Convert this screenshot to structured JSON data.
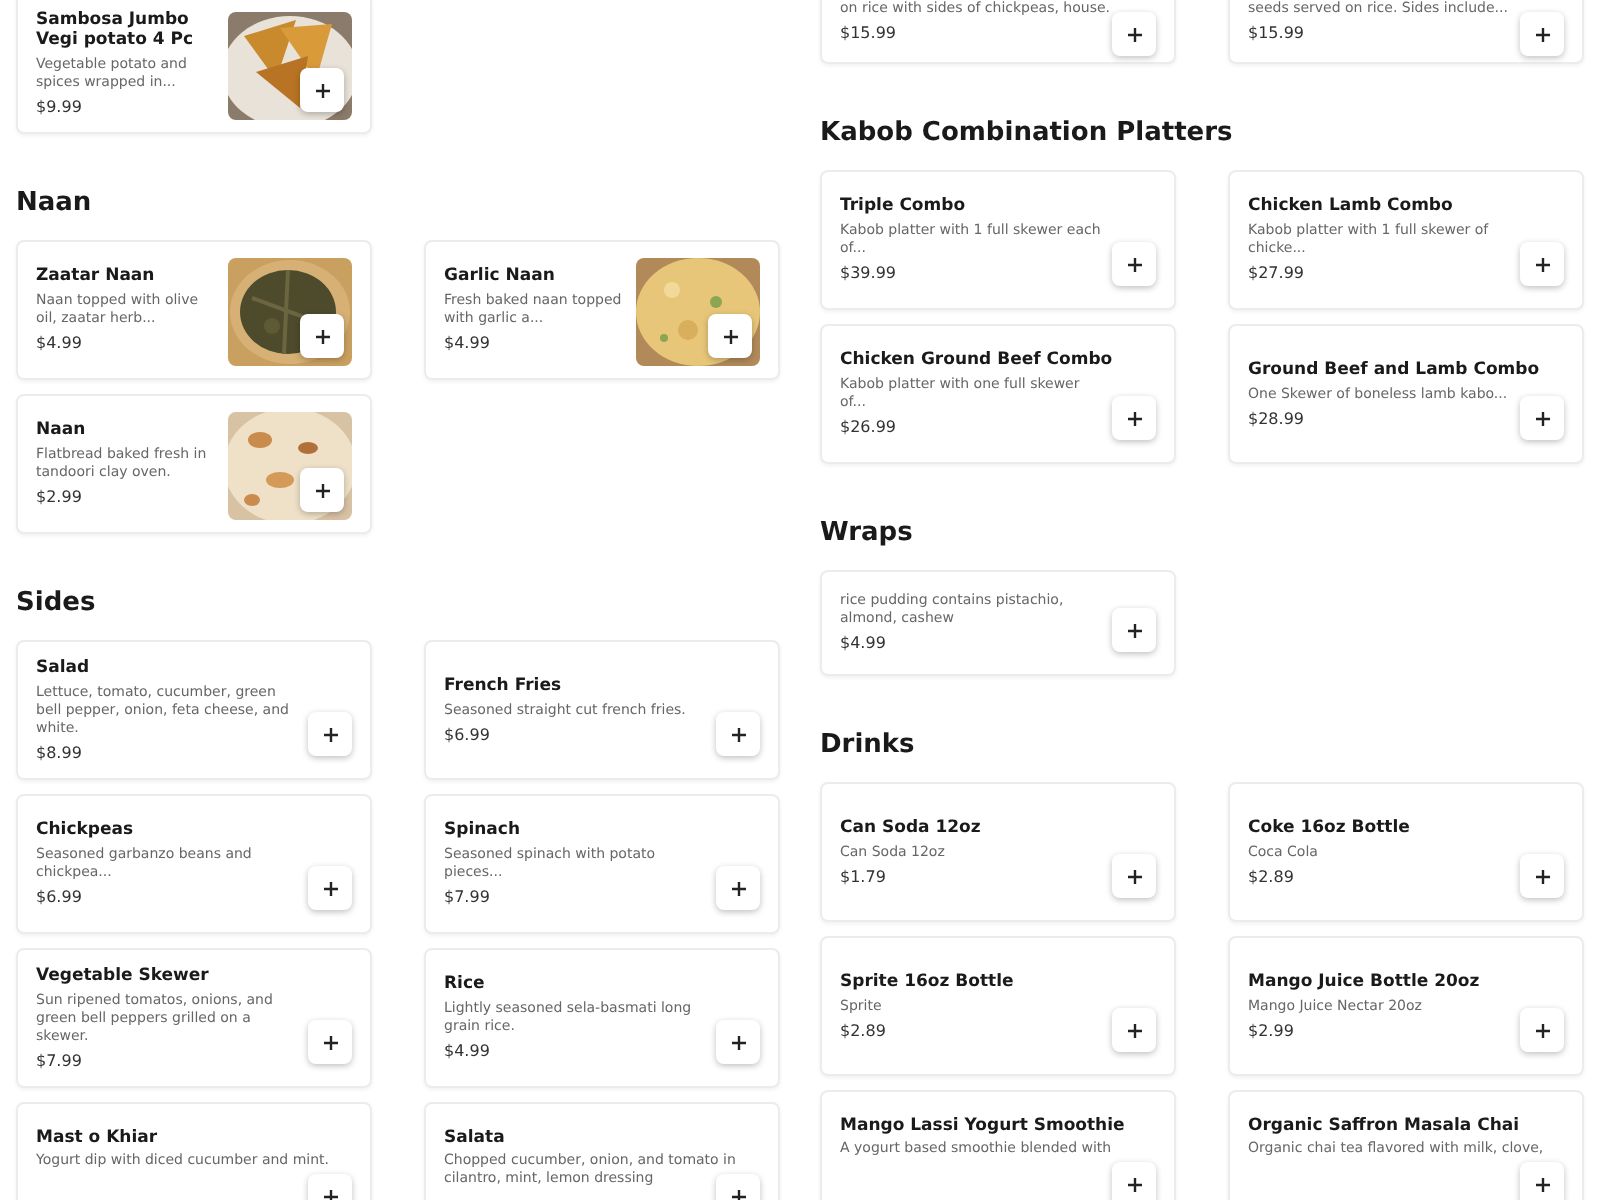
{
  "left": [
    {
      "items": [
        {
          "title": "Sambosa Jumbo Vegi potato 4 Pc",
          "description": "Vegetable potato and spices wrapped in...",
          "price": "$9.99"
        }
      ]
    },
    {
      "heading": "Naan",
      "items": [
        {
          "title": "Zaatar Naan",
          "description": "Naan topped with olive oil, zaatar herb...",
          "price": "$4.99"
        },
        {
          "title": "Garlic Naan",
          "description": "Fresh baked naan topped with garlic a...",
          "price": "$4.99"
        },
        {
          "title": "Naan",
          "description": "Flatbread baked fresh in tandoori clay oven.",
          "price": "$2.99"
        }
      ]
    },
    {
      "heading": "Sides",
      "items": [
        {
          "title": "Salad",
          "description": "Lettuce, tomato, cucumber, green bell pepper, onion, feta cheese, and white.",
          "price": "$8.99"
        },
        {
          "title": "French Fries",
          "description": "Seasoned straight cut french fries.",
          "price": "$6.99"
        },
        {
          "title": "Chickpeas",
          "description": "Seasoned garbanzo beans and chickpea...",
          "price": "$6.99"
        },
        {
          "title": "Spinach",
          "description": "Seasoned spinach with potato pieces...",
          "price": "$7.99"
        },
        {
          "title": "Vegetable Skewer",
          "description": "Sun ripened tomatos, onions, and green bell peppers grilled on a skewer.",
          "price": "$7.99"
        },
        {
          "title": "Rice",
          "description": "Lightly seasoned sela-basmati long grain rice.",
          "price": "$4.99"
        },
        {
          "title": "Mast o Khiar",
          "description": "Yogurt dip with diced cucumber and mint."
        },
        {
          "title": "Salata",
          "description": "Chopped cucumber, onion, and tomato in cilantro, mint, lemon dressing"
        }
      ]
    }
  ],
  "right": [
    {
      "items": [
        {
          "description": "on rice with sides of chickpeas, house.",
          "price": "$15.99"
        },
        {
          "description": "seeds served on rice. Sides include...",
          "price": "$15.99"
        }
      ]
    },
    {
      "heading": "Kabob Combination Platters",
      "items": [
        {
          "title": "Triple Combo",
          "description": "Kabob platter with 1 full skewer each of...",
          "price": "$39.99"
        },
        {
          "title": "Chicken Lamb Combo",
          "description": "Kabob platter with 1 full skewer of chicke...",
          "price": "$27.99"
        },
        {
          "title": "Chicken Ground Beef Combo",
          "description": "Kabob platter with one full skewer of...",
          "price": "$26.99"
        },
        {
          "title": "Ground Beef and Lamb Combo",
          "description": "One Skewer of boneless lamb kabo...",
          "price": "$28.99"
        }
      ]
    },
    {
      "heading": "Wraps",
      "items": [
        {
          "description": "rice pudding contains pistachio, almond, cashew",
          "price": "$4.99"
        }
      ]
    },
    {
      "heading": "Drinks",
      "items": [
        {
          "title": "Can Soda 12oz",
          "description": "Can Soda 12oz",
          "price": "$1.79"
        },
        {
          "title": "Coke 16oz Bottle",
          "description": "Coca Cola",
          "price": "$2.89"
        },
        {
          "title": "Sprite 16oz Bottle",
          "description": "Sprite",
          "price": "$2.89"
        },
        {
          "title": "Mango Juice Bottle 20oz",
          "description": "Mango Juice Nectar 20oz",
          "price": "$2.99"
        },
        {
          "title": "Mango Lassi Yogurt Smoothie",
          "description": "A yogurt based smoothie blended with"
        },
        {
          "title": "Organic Saffron Masala Chai",
          "description": "Organic chai tea flavored with milk, clove,"
        }
      ]
    }
  ]
}
